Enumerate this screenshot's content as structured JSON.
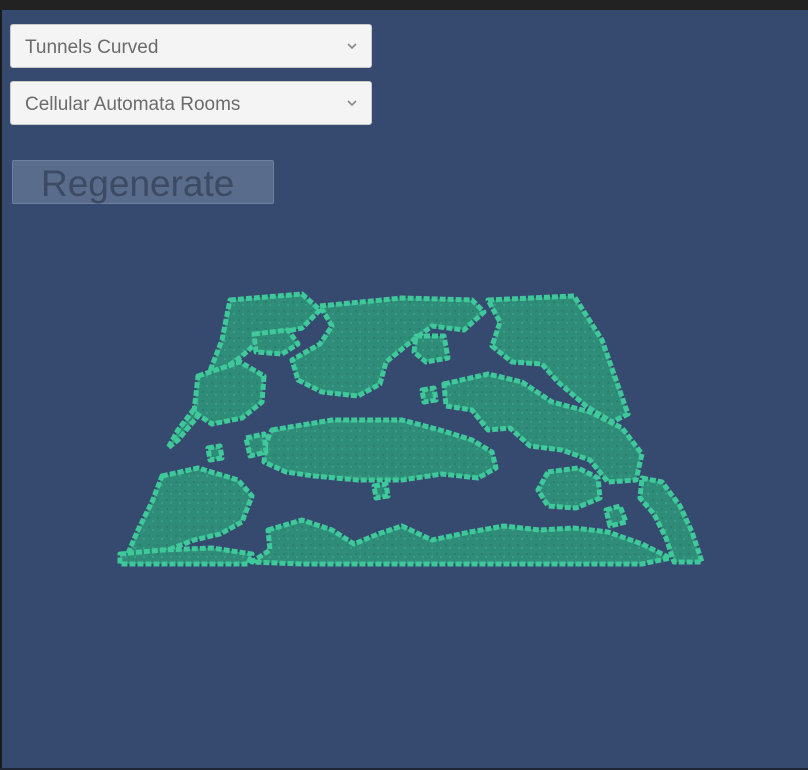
{
  "controls": {
    "layout_dropdown": {
      "value": "Tunnels Curved"
    },
    "rooms_dropdown": {
      "value": "Cellular Automata Rooms"
    },
    "regenerate_label": "Regenerate"
  },
  "icons": {
    "dropdown_arrow": "chevron-down-icon"
  },
  "colors": {
    "viewport_background": "#364a6f",
    "floor_fill": "#2f8c78",
    "wall_outline": "#3fc99a",
    "button_background": "#5a6c8c",
    "dropdown_background": "#f4f4f4"
  }
}
